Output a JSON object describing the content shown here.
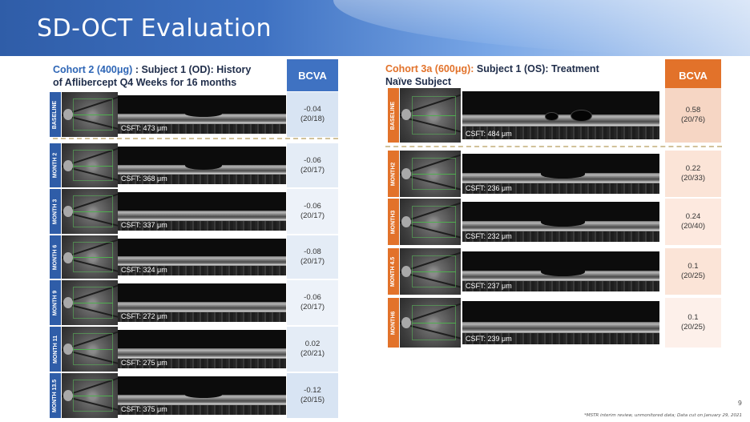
{
  "title": "SD-OCT Evaluation",
  "page_number": "9",
  "footnote": "*MSTR interim review, unmonitored data; Data cut on January 29, 2021",
  "colors": {
    "left_accent": "#2e66b6",
    "right_accent": "#e2722a",
    "left_label_bar": "#2f5da8",
    "right_label_bar": "#e2722a"
  },
  "left": {
    "cohort_label": "Cohort 2 (400μg)",
    "subject_label": ": Subject 1 (OD): History",
    "subject_line2": "of Aflibercept Q4 Weeks for 16 months",
    "bcva_header": "BCVA",
    "rows": [
      {
        "label": "BASELINE",
        "csft": "CSFT: 473 μm",
        "bcva": "-0.04",
        "snellen": "(20/18)"
      },
      {
        "label": "MONTH 2",
        "csft": "CSFT: 368 μm",
        "bcva": "-0.06",
        "snellen": "(20/17)"
      },
      {
        "label": "MONTH 3",
        "csft": "CSFT: 337 μm",
        "bcva": "-0.06",
        "snellen": "(20/17)"
      },
      {
        "label": "MONTH 6",
        "csft": "CSFT: 324 μm",
        "bcva": "-0.08",
        "snellen": "(20/17)"
      },
      {
        "label": "MONTH 9",
        "csft": "CSFT: 272 μm",
        "bcva": "-0.06",
        "snellen": "(20/17)"
      },
      {
        "label": "MONTH 11",
        "csft": "CSFT: 275 μm",
        "bcva": "0.02",
        "snellen": "(20/21)"
      },
      {
        "label": "MONTH 13.5",
        "csft": "CSFT: 375 μm",
        "bcva": "-0.12",
        "snellen": "(20/15)"
      }
    ]
  },
  "right": {
    "cohort_label": "Cohort 3a (600μg):",
    "subject_label": "Subject 1 (OS): Treatment",
    "subject_line2": "Naïve Subject",
    "bcva_header": "BCVA",
    "rows": [
      {
        "label": "BASELINE",
        "csft": "CSFT: 484 μm",
        "bcva": "0.58",
        "snellen": "(20/76)"
      },
      {
        "label": "MONTH2",
        "csft": "CSFT: 236 μm",
        "bcva": "0.22",
        "snellen": "(20/33)"
      },
      {
        "label": "MONTH3",
        "csft": "CSFT: 232 μm",
        "bcva": "0.24",
        "snellen": "(20/40)"
      },
      {
        "label": "MONTH 4.5",
        "csft": "CSFT: 237 μm",
        "bcva": "0.1",
        "snellen": "(20/25)"
      },
      {
        "label": "MONTH6",
        "csft": "CSFT: 239 μm",
        "bcva": "0.1",
        "snellen": "(20/25)"
      }
    ]
  }
}
